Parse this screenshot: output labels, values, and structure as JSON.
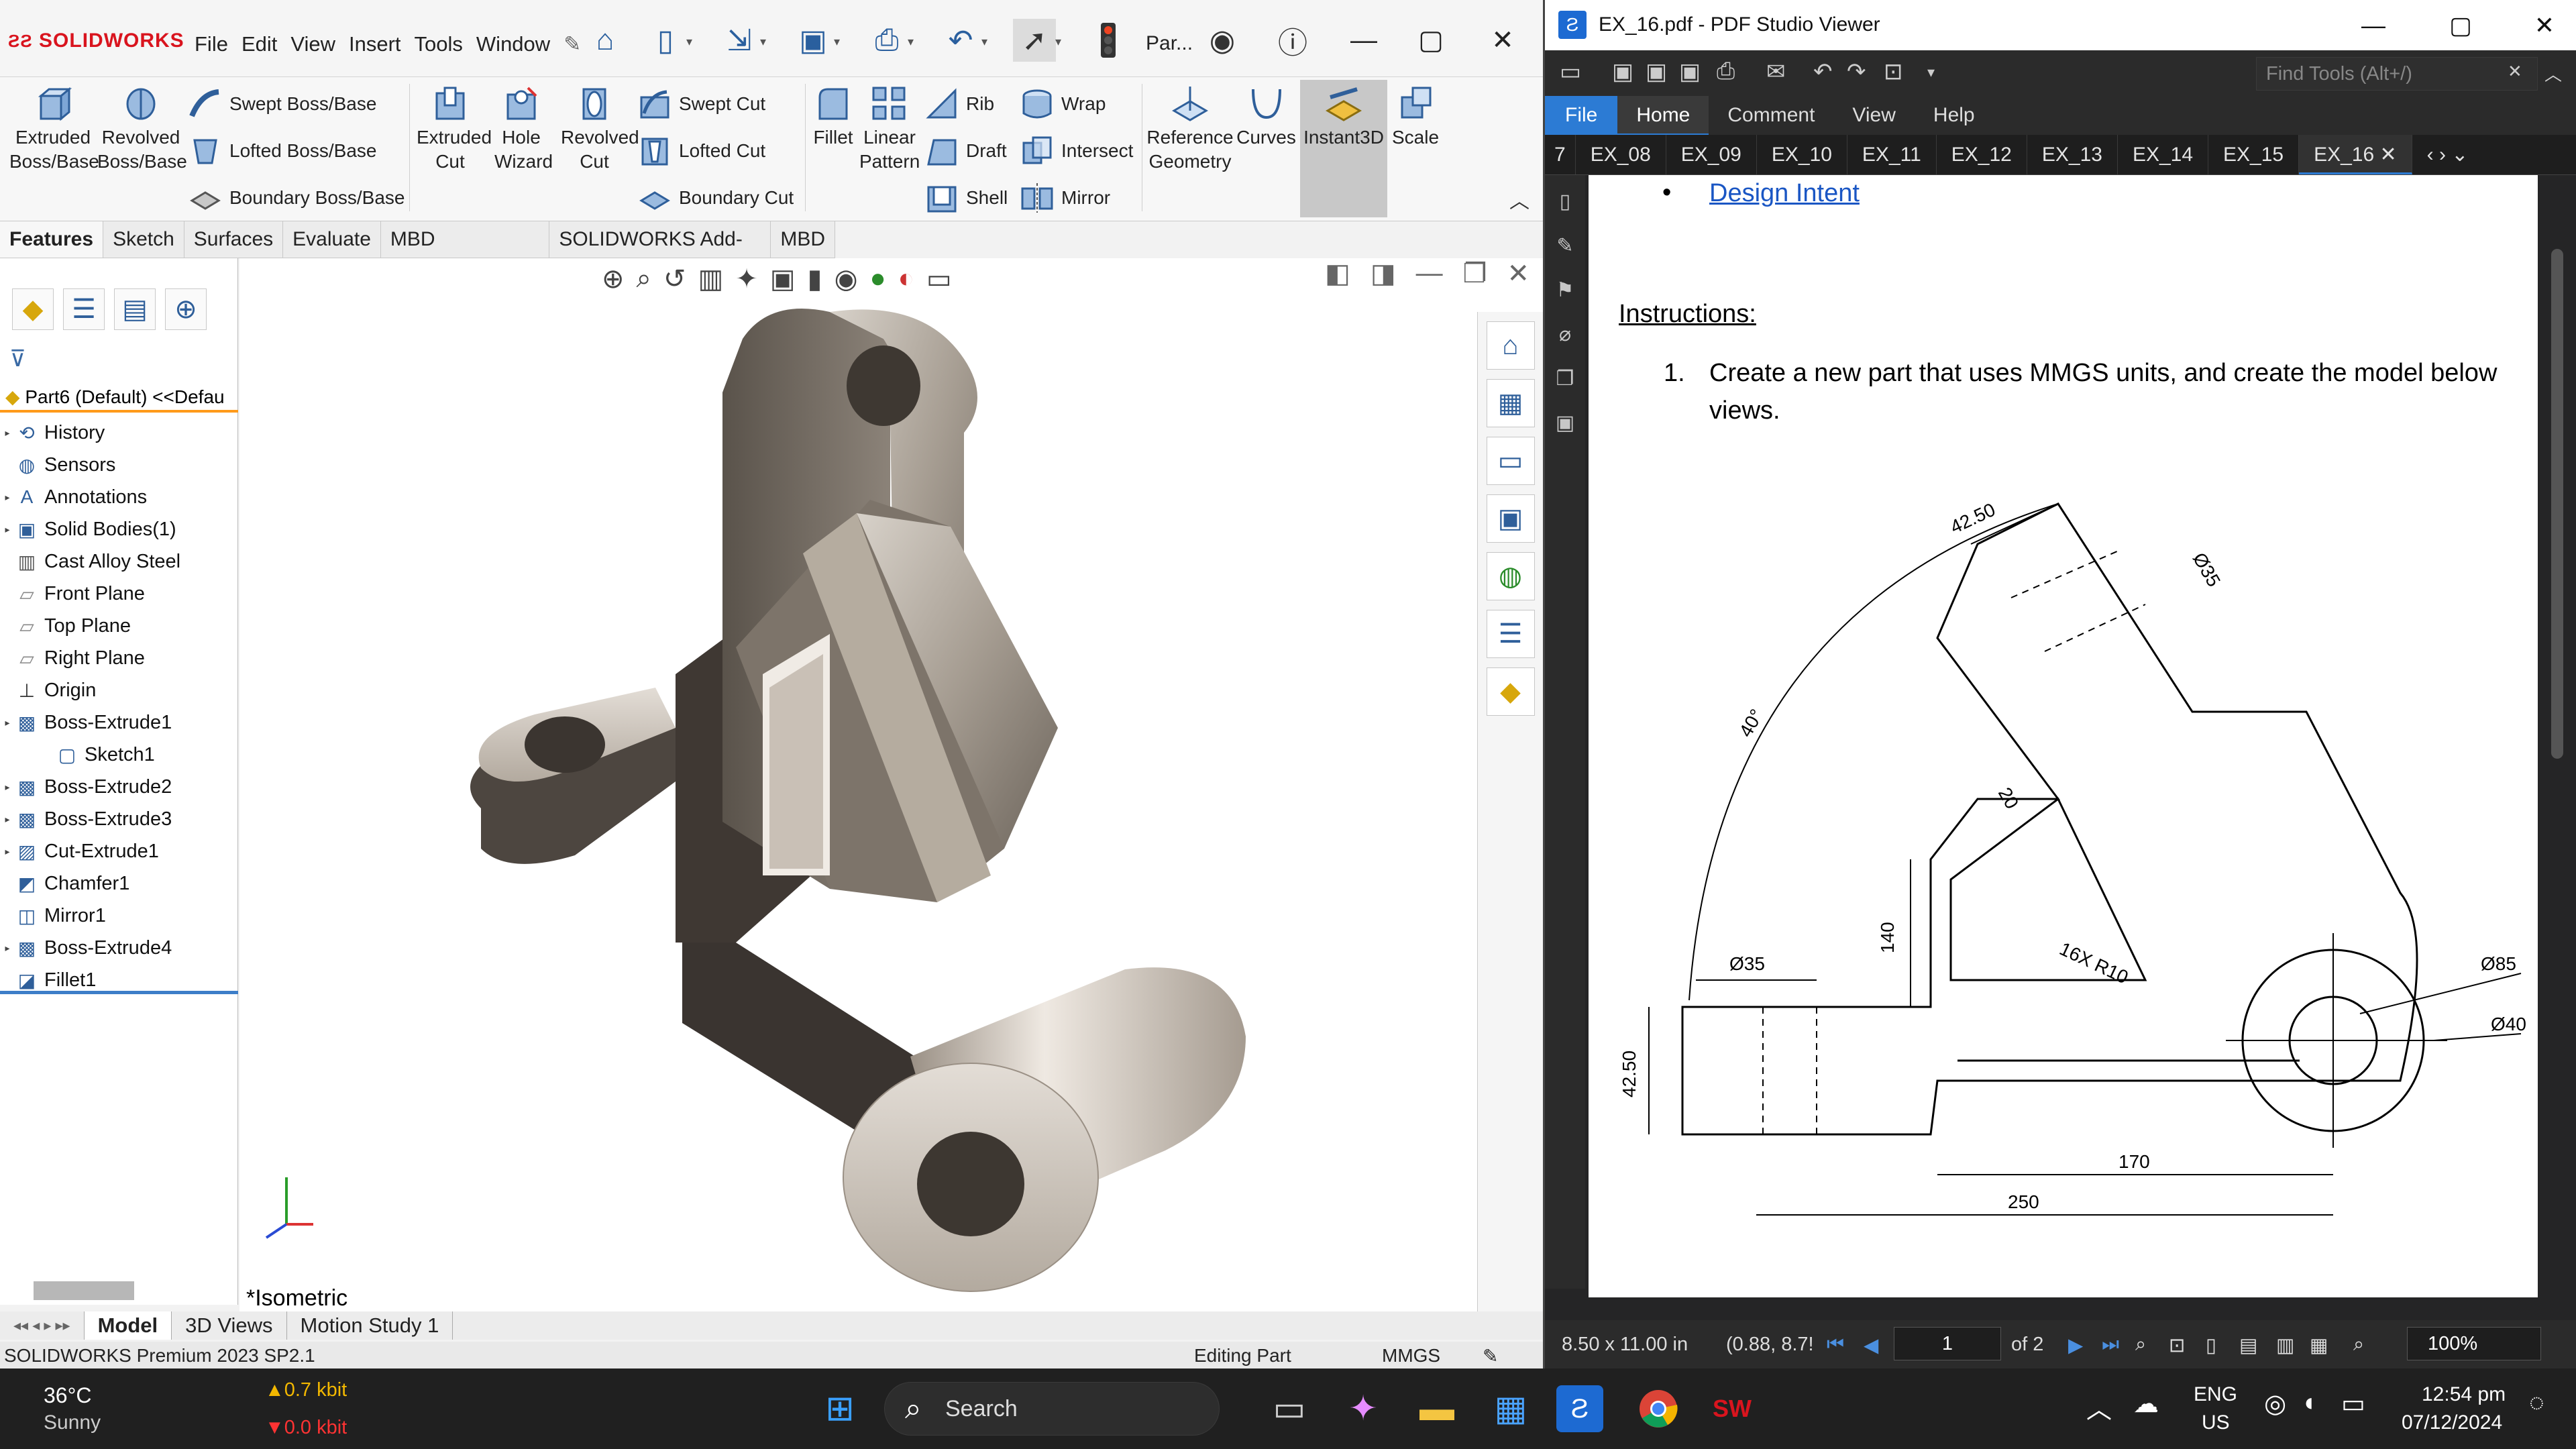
{
  "solidworks": {
    "logo": "SOLIDWORKS",
    "menus": [
      "File",
      "Edit",
      "View",
      "Insert",
      "Tools",
      "Window"
    ],
    "doc_name": "Par...",
    "tools": {
      "extruded_boss": "Extruded Boss/Base",
      "revolved_boss": "Revolved Boss/Base",
      "swept_boss": "Swept Boss/Base",
      "lofted_boss": "Lofted Boss/Base",
      "boundary_boss": "Boundary Boss/Base",
      "extruded_cut": "Extruded Cut",
      "hole_wizard": "Hole Wizard",
      "revolved_cut": "Revolved Cut",
      "swept_cut": "Swept Cut",
      "lofted_cut": "Lofted Cut",
      "boundary_cut": "Boundary Cut",
      "fillet": "Fillet",
      "linear_pattern": "Linear Pattern",
      "rib": "Rib",
      "draft": "Draft",
      "shell": "Shell",
      "wrap": "Wrap",
      "intersect": "Intersect",
      "mirror": "Mirror",
      "reference_geometry": "Reference Geometry",
      "curves": "Curves",
      "instant3d": "Instant3D",
      "scale": "Scale"
    },
    "feature_tabs": [
      "Features",
      "Sketch",
      "Surfaces",
      "Evaluate",
      "MBD Dimensions",
      "SOLIDWORKS Add-Ins",
      "MBD"
    ],
    "part_node": "Part6 (Default) <<Defau",
    "tree": [
      {
        "label": "History",
        "icon": "history-icon",
        "expandable": true
      },
      {
        "label": "Sensors",
        "icon": "sensor-icon",
        "expandable": false
      },
      {
        "label": "Annotations",
        "icon": "annotation-icon",
        "expandable": true
      },
      {
        "label": "Solid Bodies(1)",
        "icon": "solid-bodies-icon",
        "expandable": true
      },
      {
        "label": "Cast Alloy Steel",
        "icon": "material-icon",
        "expandable": false
      },
      {
        "label": "Front Plane",
        "icon": "plane-icon",
        "expandable": false
      },
      {
        "label": "Top Plane",
        "icon": "plane-icon",
        "expandable": false
      },
      {
        "label": "Right Plane",
        "icon": "plane-icon",
        "expandable": false
      },
      {
        "label": "Origin",
        "icon": "origin-icon",
        "expandable": false
      },
      {
        "label": "Boss-Extrude1",
        "icon": "extrude-icon",
        "expandable": true
      },
      {
        "label": "Sketch1",
        "icon": "sketch-icon",
        "expandable": false,
        "child": true
      },
      {
        "label": "Boss-Extrude2",
        "icon": "extrude-icon",
        "expandable": true
      },
      {
        "label": "Boss-Extrude3",
        "icon": "extrude-icon",
        "expandable": true
      },
      {
        "label": "Cut-Extrude1",
        "icon": "cut-extrude-icon",
        "expandable": true
      },
      {
        "label": "Chamfer1",
        "icon": "chamfer-icon",
        "expandable": false
      },
      {
        "label": "Mirror1",
        "icon": "mirror-icon",
        "expandable": false
      },
      {
        "label": "Boss-Extrude4",
        "icon": "extrude-icon",
        "expandable": true
      },
      {
        "label": "Fillet1",
        "icon": "fillet-icon",
        "expandable": false
      }
    ],
    "view_label": "*Isometric",
    "bottom_tabs": [
      "Model",
      "3D Views",
      "Motion Study 1"
    ],
    "status": {
      "version": "SOLIDWORKS Premium 2023 SP2.1",
      "mode": "Editing Part",
      "units": "MMGS"
    },
    "colors": {
      "brand": "#d9141e",
      "accent": "#ff9a1a",
      "selection": "#3d7ec8"
    }
  },
  "pdf": {
    "title": "EX_16.pdf - PDF Studio Viewer",
    "find_placeholder": "Find Tools  (Alt+/)",
    "menu": [
      "File",
      "Home",
      "Comment",
      "View",
      "Help"
    ],
    "tabs": [
      "7",
      "EX_08",
      "EX_09",
      "EX_10",
      "EX_11",
      "EX_12",
      "EX_13",
      "EX_14",
      "EX_15",
      "EX_16"
    ],
    "active_tab": "EX_16",
    "page": {
      "link": "Design Intent",
      "heading": "Instructions:",
      "step_num": "1.",
      "step_line1": "Create a new part that uses MMGS units, and create the model below",
      "step_line2": "views."
    },
    "drawing": {
      "dims": {
        "d4250_top": "42.50",
        "d35_top": "Ø35",
        "a40": "40°",
        "d20": "20",
        "r10": "16X R10",
        "d140": "140",
        "d35_left": "Ø35",
        "d4250_left": "42.50",
        "d85": "Ø85",
        "d40": "Ø40",
        "d170": "170",
        "d250": "250"
      }
    },
    "status": {
      "page_size": "8.50 x 11.00 in",
      "coords": "(0.88, 8.7!",
      "page_current": "1",
      "page_total": "of 2",
      "zoom": "100%"
    },
    "colors": {
      "accent": "#2c7bd4",
      "link": "#1a56c4"
    }
  },
  "taskbar": {
    "weather_temp": "36°C",
    "weather_desc": "Sunny",
    "net_up": "▲0.7 kbit",
    "net_down": "▼0.0 kbit",
    "search": "Search",
    "lang_1": "ENG",
    "lang_2": "US",
    "time": "12:54 pm",
    "date": "07/12/2024"
  }
}
